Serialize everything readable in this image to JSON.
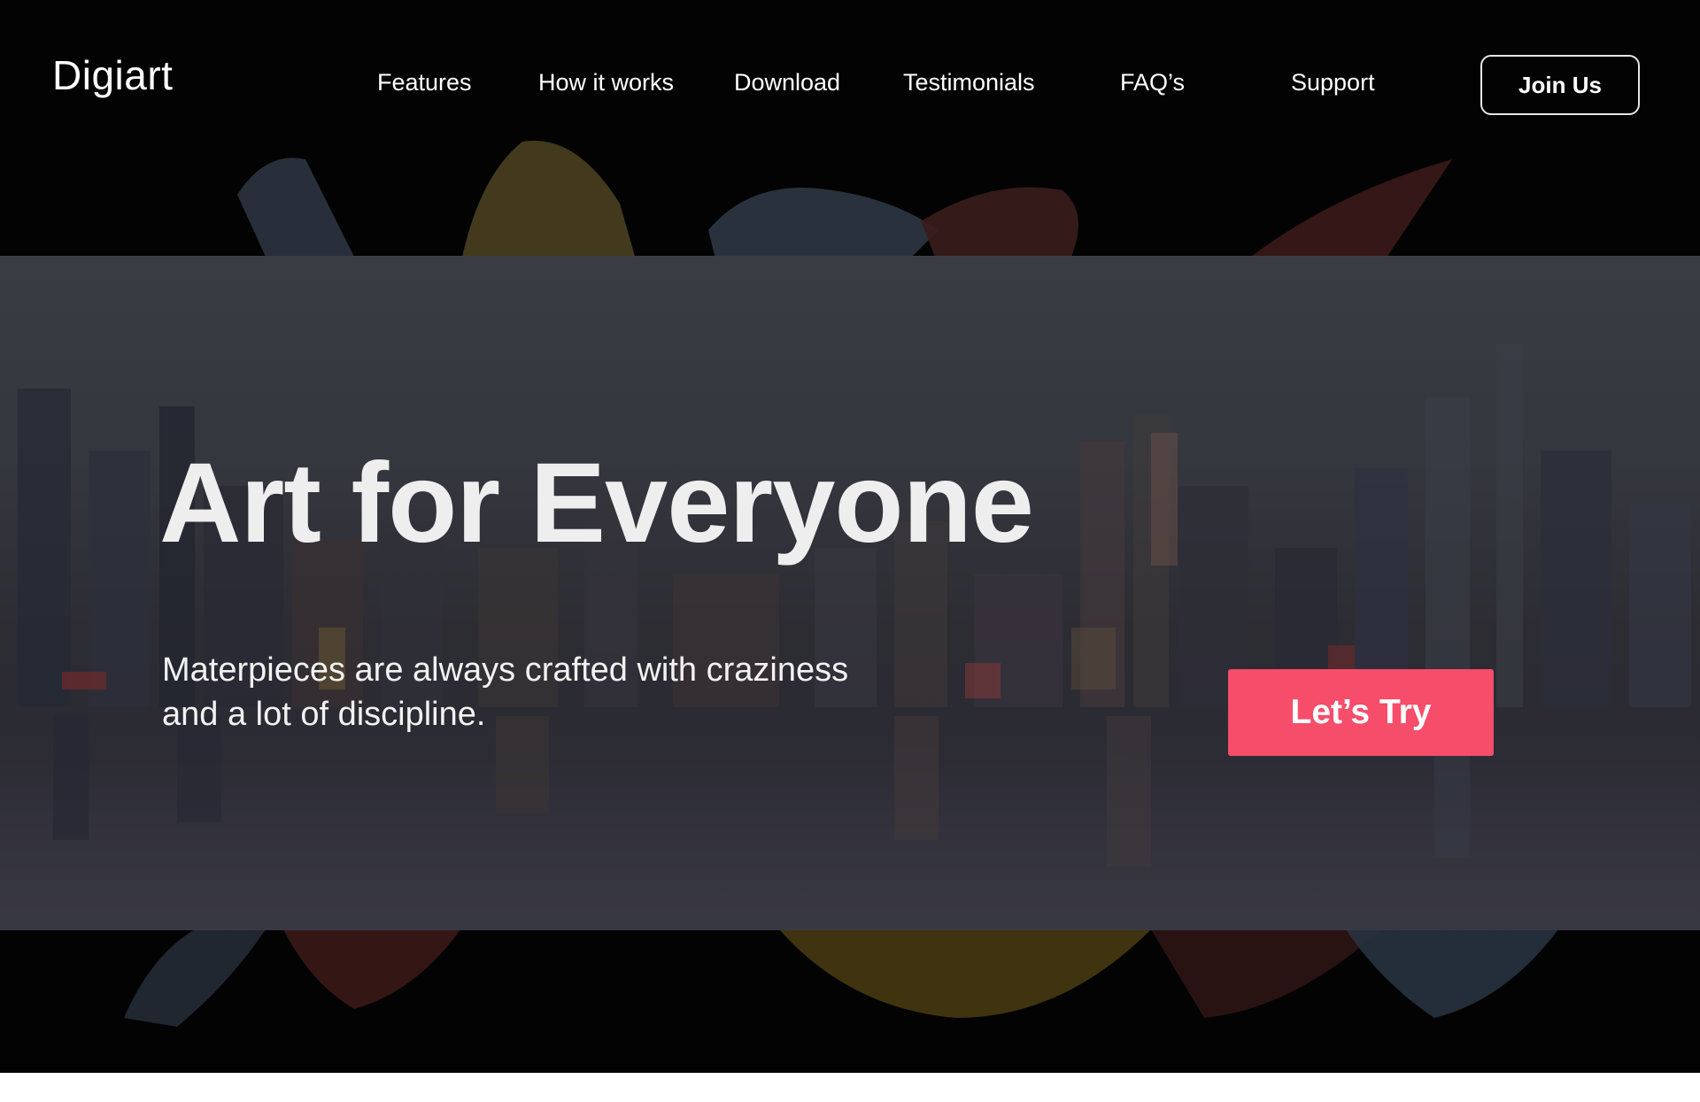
{
  "brand": {
    "logo": "Digiart"
  },
  "nav": {
    "items": [
      {
        "label": "Features"
      },
      {
        "label": "How it works"
      },
      {
        "label": "Download"
      },
      {
        "label": "Testimonials"
      },
      {
        "label": "FAQ’s"
      },
      {
        "label": "Support"
      }
    ],
    "join_label": "Join Us"
  },
  "hero": {
    "headline": "Art for Everyone",
    "subtitle": "Materpieces are always crafted with craziness and a lot of discipline.",
    "cta_label": "Let’s Try"
  },
  "colors": {
    "background": "#030303",
    "cta": "#f54d6a",
    "text": "#ffffff"
  }
}
